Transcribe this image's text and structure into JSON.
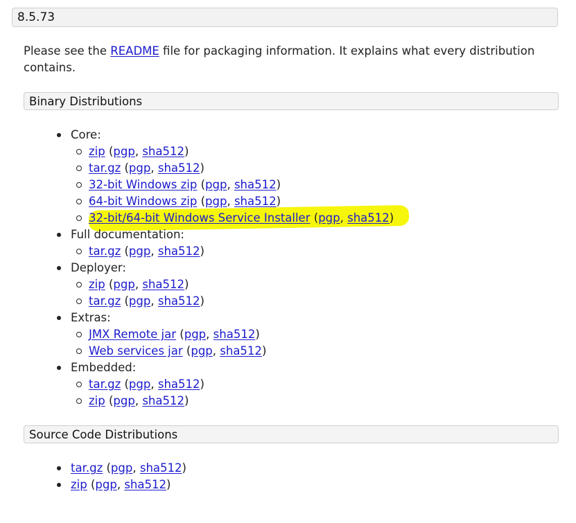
{
  "version_title": "8.5.73",
  "intro": {
    "prefix": "Please see the ",
    "readme_link": "README",
    "suffix": " file for packaging information. It explains what every distribution contains."
  },
  "binary": {
    "title": "Binary Distributions",
    "groups": [
      {
        "label": "Core:",
        "items": [
          {
            "name": "zip",
            "pgp": "pgp",
            "sha": "sha512"
          },
          {
            "name": "tar.gz",
            "pgp": "pgp",
            "sha": "sha512"
          },
          {
            "name": "32-bit Windows zip",
            "pgp": "pgp",
            "sha": "sha512"
          },
          {
            "name": "64-bit Windows zip",
            "pgp": "pgp",
            "sha": "sha512"
          },
          {
            "name": "32-bit/64-bit Windows Service Installer",
            "pgp": "pgp",
            "sha": "sha512",
            "highlighted": true
          }
        ]
      },
      {
        "label": "Full documentation:",
        "items": [
          {
            "name": "tar.gz",
            "pgp": "pgp",
            "sha": "sha512"
          }
        ]
      },
      {
        "label": "Deployer:",
        "items": [
          {
            "name": "zip",
            "pgp": "pgp",
            "sha": "sha512"
          },
          {
            "name": "tar.gz",
            "pgp": "pgp",
            "sha": "sha512"
          }
        ]
      },
      {
        "label": "Extras:",
        "items": [
          {
            "name": "JMX Remote jar",
            "pgp": "pgp",
            "sha": "sha512"
          },
          {
            "name": "Web services jar",
            "pgp": "pgp",
            "sha": "sha512"
          }
        ]
      },
      {
        "label": "Embedded:",
        "items": [
          {
            "name": "tar.gz",
            "pgp": "pgp",
            "sha": "sha512"
          },
          {
            "name": "zip",
            "pgp": "pgp",
            "sha": "sha512"
          }
        ]
      }
    ]
  },
  "source": {
    "title": "Source Code Distributions",
    "items": [
      {
        "name": "tar.gz",
        "pgp": "pgp",
        "sha": "sha512"
      },
      {
        "name": "zip",
        "pgp": "pgp",
        "sha": "sha512"
      }
    ]
  },
  "punctuation": {
    "open": " (",
    "sep": ", ",
    "close": ")"
  },
  "colors": {
    "link": "#1a1acc",
    "highlight": "#f5f500"
  }
}
